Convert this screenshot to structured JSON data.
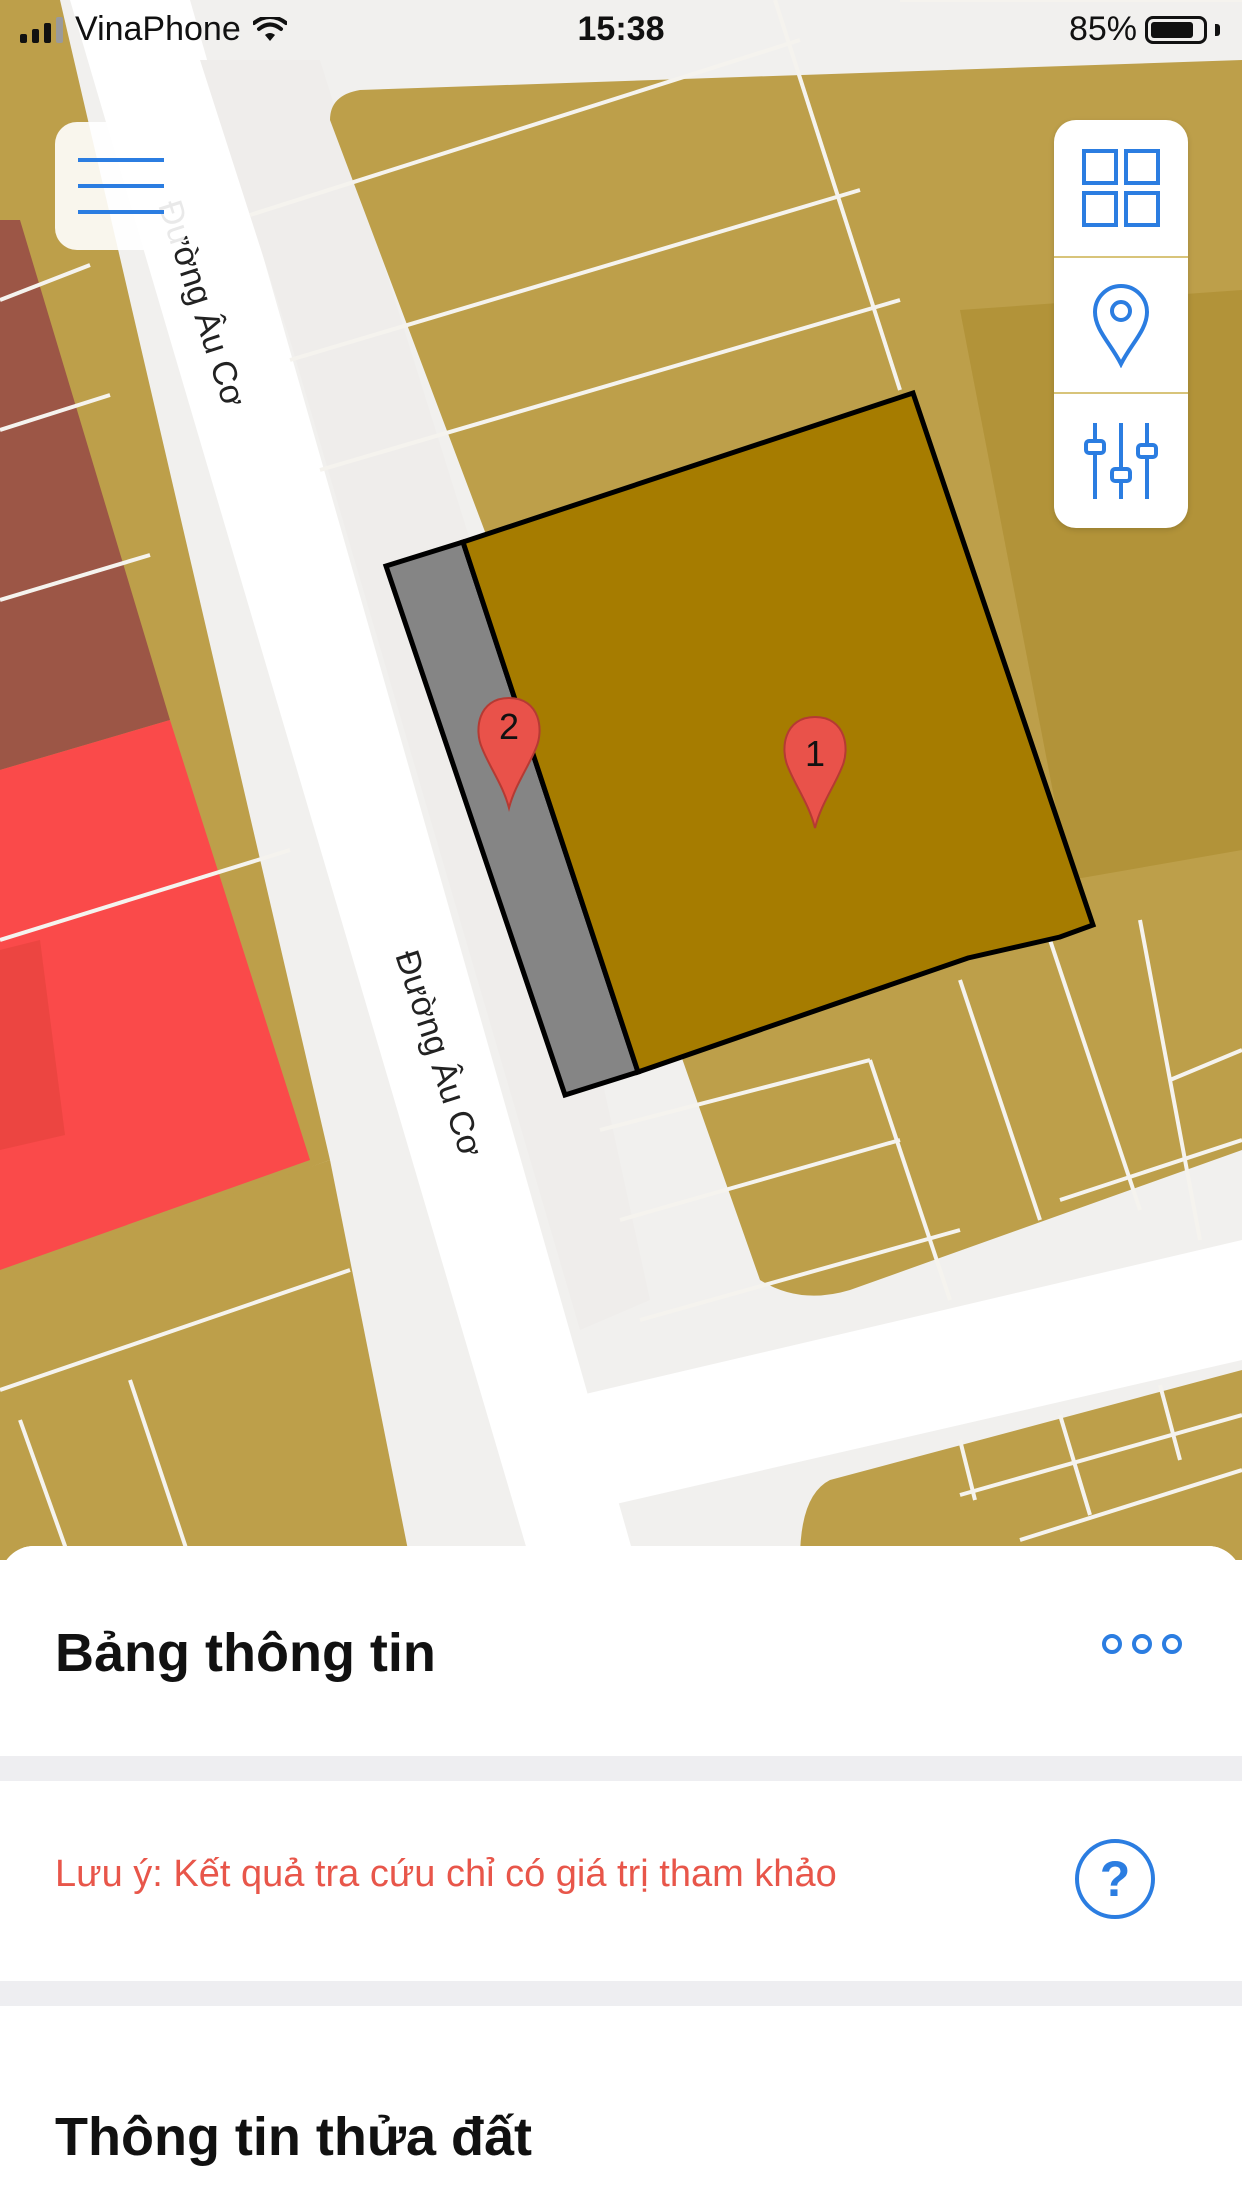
{
  "status_bar": {
    "carrier": "VinaPhone",
    "time": "15:38",
    "battery_text": "85%",
    "battery_level": 0.85
  },
  "map": {
    "road_labels": [
      "Đường Âu Cơ",
      "Đường Âu Cơ"
    ],
    "markers": [
      {
        "label": "1",
        "color": "#e9524a"
      },
      {
        "label": "2",
        "color": "#e9524a"
      }
    ],
    "colors": {
      "land": "#bd9f4a",
      "selected_parcel": "#a67c00",
      "selected_strip": "#858585",
      "road": "#f1f0ee",
      "residential_dark": "#9c5646",
      "red_zone": "#fa4a4a"
    }
  },
  "toolbar": {
    "menu_icon": "hamburger-icon",
    "layers_icon": "grid-icon",
    "location_icon": "location-pin-icon",
    "filter_icon": "sliders-icon"
  },
  "sheet": {
    "title": "Bảng thông tin",
    "more_icon": "more-icon",
    "note": "Lưu ý: Kết quả tra cứu chỉ có giá trị tham khảo",
    "help_label": "?",
    "section_title": "Thông tin thửa đất"
  },
  "accent_color": "#2b7de1"
}
